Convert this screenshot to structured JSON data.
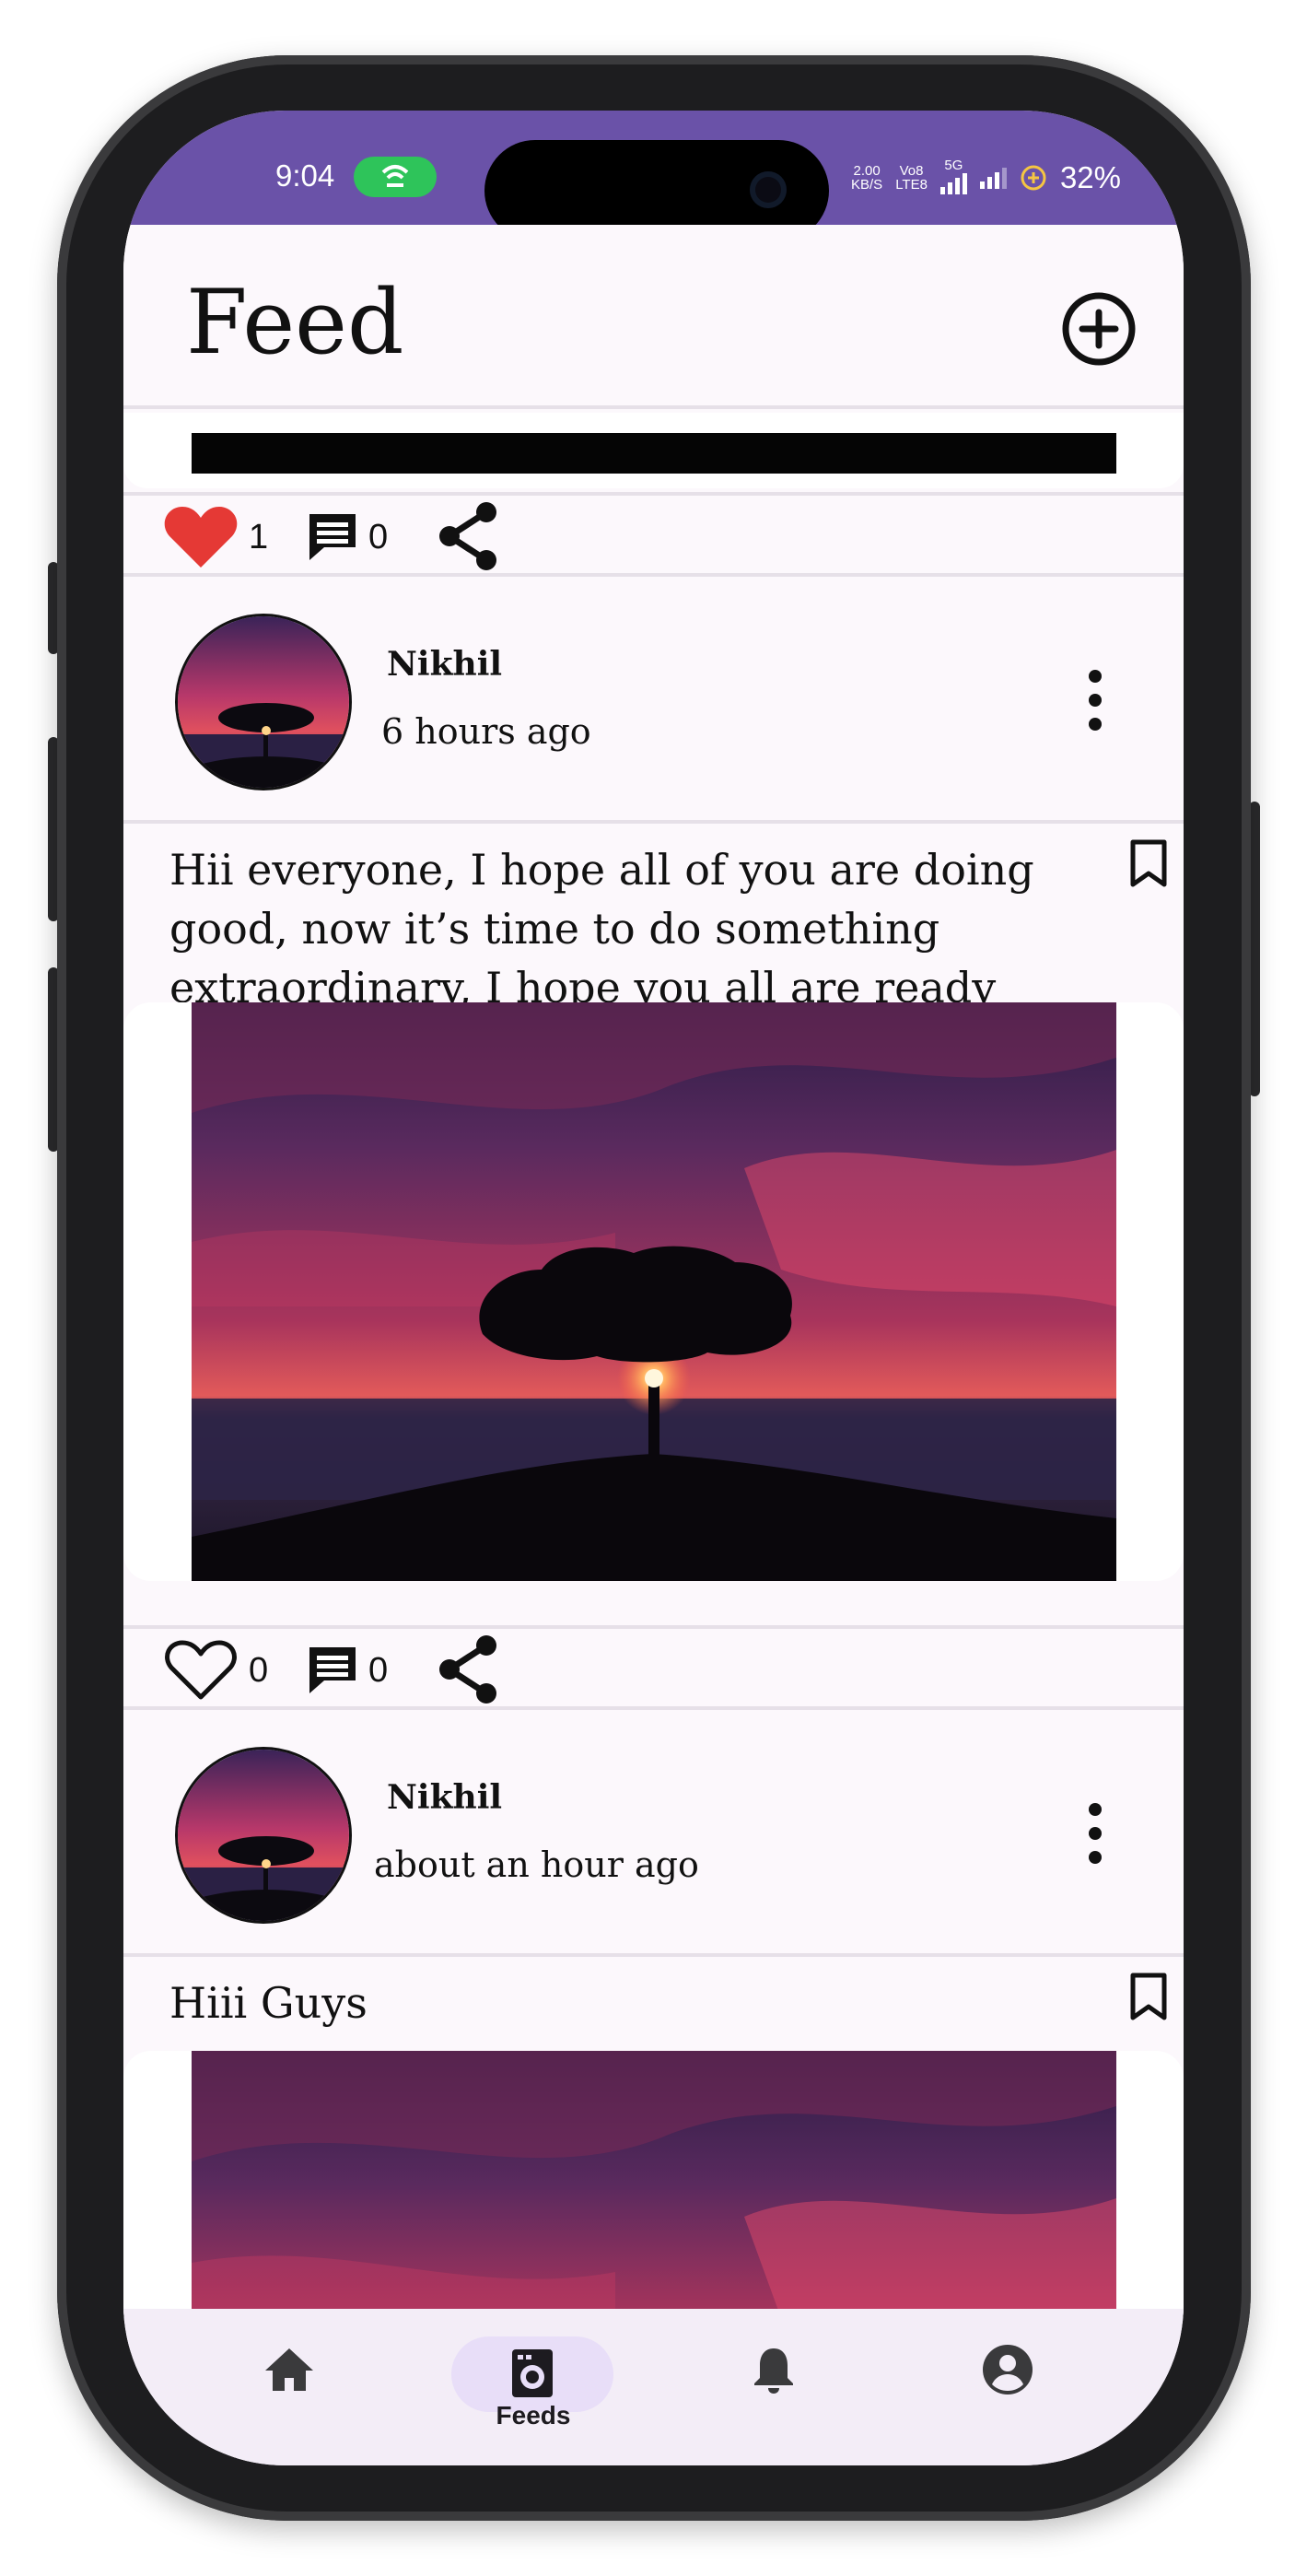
{
  "status_bar": {
    "time": "9:04",
    "net_speed_top": "2.00",
    "net_speed_bottom": "KB/S",
    "volte_top": "Vo8",
    "volte_bottom": "LTE8",
    "network": "5G",
    "battery": "32%",
    "color": "#6a52a8"
  },
  "app_bar": {
    "title": "Feed",
    "add_icon": "add-circle-icon"
  },
  "posts": [
    {
      "likes": "1",
      "comments": "0",
      "liked": true
    },
    {
      "author": "Nikhil",
      "time": "6 hours ago",
      "text": "Hii everyone, I hope all of you are doing good, now it’s time to do something extraordinary, I hope you all are ready",
      "likes": "0",
      "comments": "0",
      "liked": false
    },
    {
      "author": "Nikhil",
      "time": "about an hour ago",
      "text": "Hiii Guys"
    }
  ],
  "bottom_nav": {
    "items": [
      {
        "icon": "home-icon"
      },
      {
        "icon": "feeds-icon",
        "label": "Feeds",
        "active": true
      },
      {
        "icon": "bell-icon"
      },
      {
        "icon": "account-icon"
      }
    ]
  },
  "colors": {
    "like_red": "#e53935",
    "nav_bg": "#f3edf7",
    "nav_active": "#e8def8",
    "background": "#fcf8fc"
  }
}
